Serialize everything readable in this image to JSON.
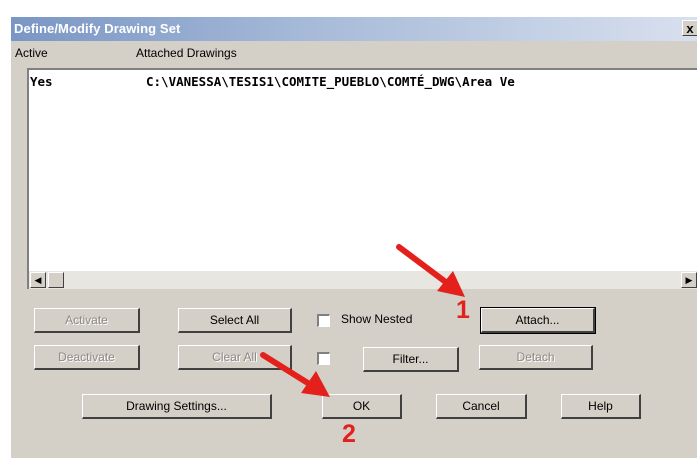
{
  "window": {
    "title": "Define/Modify Drawing Set",
    "close_glyph": "x"
  },
  "list": {
    "columns": [
      "Active",
      "Attached Drawings"
    ],
    "rows": [
      {
        "active": "Yes",
        "path": "C:\\VANESSA\\TESIS1\\COMITE_PUEBLO\\COMTÉ_DWG\\Area Ve"
      }
    ]
  },
  "scrollbar": {
    "left_glyph": "◀",
    "right_glyph": "▶"
  },
  "buttons": {
    "activate": "Activate",
    "select_all": "Select All",
    "attach": "Attach...",
    "deactivate": "Deactivate",
    "clear_all": "Clear All",
    "filter": "Filter...",
    "detach": "Detach",
    "drawing_settings": "Drawing Settings...",
    "ok": "OK",
    "cancel": "Cancel",
    "help": "Help"
  },
  "checkboxes": {
    "show_nested": "Show Nested",
    "filter_checked": false,
    "show_nested_checked": false
  },
  "annotations": {
    "marker_1": "1",
    "marker_2": "2",
    "arrow_color": "#e4201c"
  }
}
